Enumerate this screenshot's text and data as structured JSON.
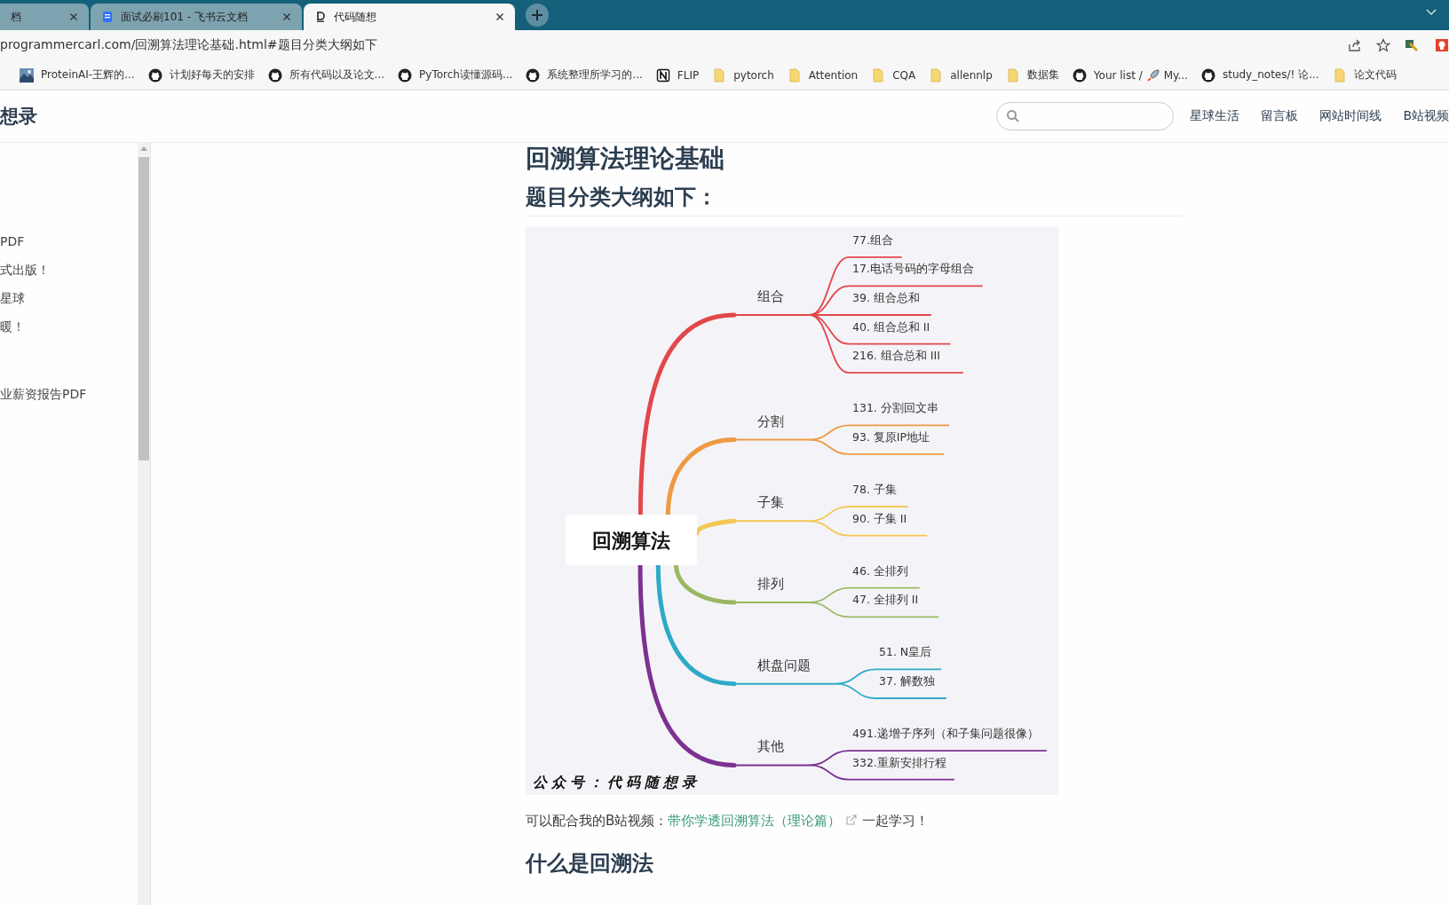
{
  "tabs": [
    {
      "title": "档",
      "kind": "plain",
      "selected": false
    },
    {
      "title": "面试必刷101 - 飞书云文档",
      "kind": "document",
      "selected": false
    },
    {
      "title": "代码随想",
      "kind": "website",
      "selected": true
    }
  ],
  "address_bar": {
    "url": "programmercarl.com/回溯算法理论基础.html#题目分类大纲如下"
  },
  "bookmarks": [
    {
      "label": "ProteinAI-王辉的..."
    },
    {
      "kind": "github",
      "label": "计划好每天的安排"
    },
    {
      "kind": "github",
      "label": "所有代码以及论文..."
    },
    {
      "kind": "github",
      "label": "PyTorch读懂源码..."
    },
    {
      "kind": "github",
      "label": "系统整理所学习的..."
    },
    {
      "kind": "notion",
      "label": "FLIP"
    },
    {
      "kind": "folder",
      "label": "pytorch"
    },
    {
      "kind": "folder",
      "label": "Attention"
    },
    {
      "kind": "folder",
      "label": "CQA"
    },
    {
      "kind": "folder",
      "label": "allennlp"
    },
    {
      "kind": "folder",
      "label": "数据集"
    },
    {
      "kind": "github",
      "label": "Your list /",
      "label_after_rocket": "My..."
    },
    {
      "kind": "github",
      "label": "study_notes/!  论..."
    },
    {
      "kind": "folder",
      "label": "论文代码"
    }
  ],
  "site_header": {
    "logo": "想录",
    "nav": [
      "星球生活",
      "留言板",
      "网站时间线",
      "B站视频"
    ]
  },
  "sidebar": {
    "items": [
      "PDF",
      "式出版！",
      "星球",
      "暖！",
      "业薪资报告PDF"
    ]
  },
  "article": {
    "title": "回溯算法理论基础",
    "section_heading": "题目分类大纲如下：",
    "mindmap": {
      "root": "回溯算法",
      "signature": "公众号：代码随想录",
      "branches": [
        {
          "label": "组合",
          "color": "#e2474b",
          "children": [
            {
              "label": "77.组合"
            },
            {
              "label": "17.电话号码的字母组合"
            },
            {
              "label": "39. 组合总和"
            },
            {
              "label": "40. 组合总和 II"
            },
            {
              "label": "216. 组合总和 III"
            }
          ]
        },
        {
          "label": "分割",
          "color": "#ee9a42",
          "children": [
            {
              "label": "131. 分割回文串"
            },
            {
              "label": "93. 复原IP地址"
            }
          ]
        },
        {
          "label": "子集",
          "color": "#f2c754",
          "children": [
            {
              "label": "78. 子集"
            },
            {
              "label": "90. 子集 II"
            }
          ]
        },
        {
          "label": "排列",
          "color": "#9ab862",
          "children": [
            {
              "label": "46. 全排列"
            },
            {
              "label": "47. 全排列 II"
            }
          ]
        },
        {
          "label": "棋盘问题",
          "color": "#2eaac8",
          "children": [
            {
              "label": "51. N皇后"
            },
            {
              "label": "37. 解数独"
            }
          ]
        },
        {
          "label": "其他",
          "color": "#7c3191",
          "children": [
            {
              "label": "491.递增子序列（和子集问题很像）"
            },
            {
              "label": "332.重新安排行程"
            }
          ]
        }
      ]
    },
    "paragraph": {
      "before": "可以配合我的B站视频：",
      "link": "带你学透回溯算法（理论篇）",
      "after": "一起学习！"
    },
    "next_heading": "什么是回溯法"
  }
}
